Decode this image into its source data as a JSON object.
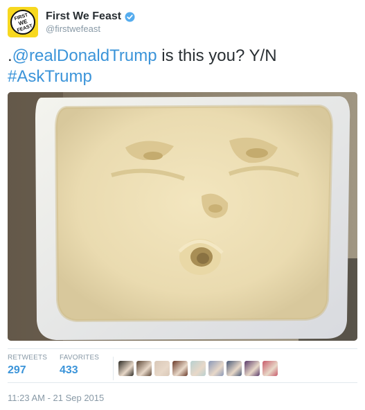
{
  "tweet": {
    "author": {
      "display_name": "First We Feast",
      "handle": "@firstwefeast",
      "verified": true,
      "avatar_text_top": "FIRST",
      "avatar_text_mid": "WE",
      "avatar_text_bottom": "FEAST"
    },
    "text": {
      "prefix": ".",
      "mention": "@realDonaldTrump",
      "middle": " is this you? Y/N",
      "hashtag": "#AskTrump"
    },
    "media": {
      "icon": "butter-face-photo"
    },
    "stats": {
      "retweets_label": "RETWEETS",
      "retweets_count": "297",
      "favorites_label": "FAVORITES",
      "favorites_count": "433"
    },
    "favoriter_avatars": [
      "#2c2a24",
      "#5b4636",
      "#d9c8b8",
      "#6a3a2a",
      "#b8d0d0",
      "#8a98b8",
      "#4a5a78",
      "#5a3a6a",
      "#c85a6a"
    ],
    "timestamp": "11:23 AM - 21 Sep 2015",
    "colors": {
      "link": "#3b94d9",
      "secondary_text": "#8899a6",
      "avatar_bg": "#f7d81f",
      "verified_badge": "#55acee"
    }
  }
}
